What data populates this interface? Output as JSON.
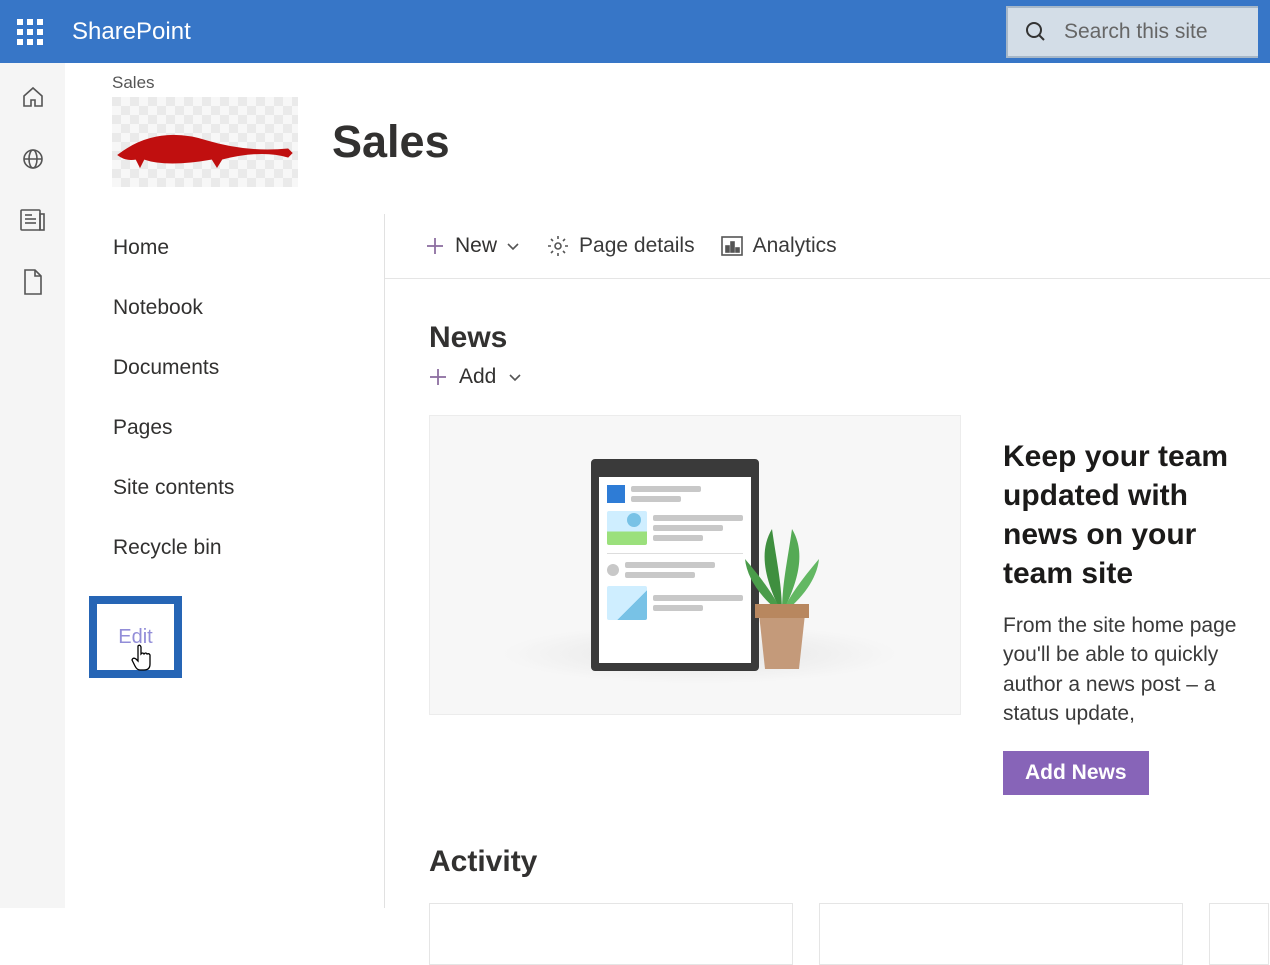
{
  "header": {
    "app_name": "SharePoint",
    "search_placeholder": "Search this site"
  },
  "site": {
    "breadcrumb": "Sales",
    "title": "Sales"
  },
  "nav": {
    "home": "Home",
    "notebook": "Notebook",
    "documents": "Documents",
    "pages": "Pages",
    "site_contents": "Site contents",
    "recycle_bin": "Recycle bin",
    "edit": "Edit"
  },
  "commands": {
    "new": "New",
    "page_details": "Page details",
    "analytics": "Analytics"
  },
  "news": {
    "heading": "News",
    "add": "Add",
    "promo_title": "Keep your team updated with news on your team site",
    "promo_body": "From the site home page you'll be able to quickly author a news post – a status update,",
    "button": "Add News"
  },
  "activity": {
    "heading": "Activity"
  },
  "colors": {
    "topbar": "#3776c7",
    "accent_purple": "#8764b8",
    "edit_highlight": "#2665b5"
  }
}
